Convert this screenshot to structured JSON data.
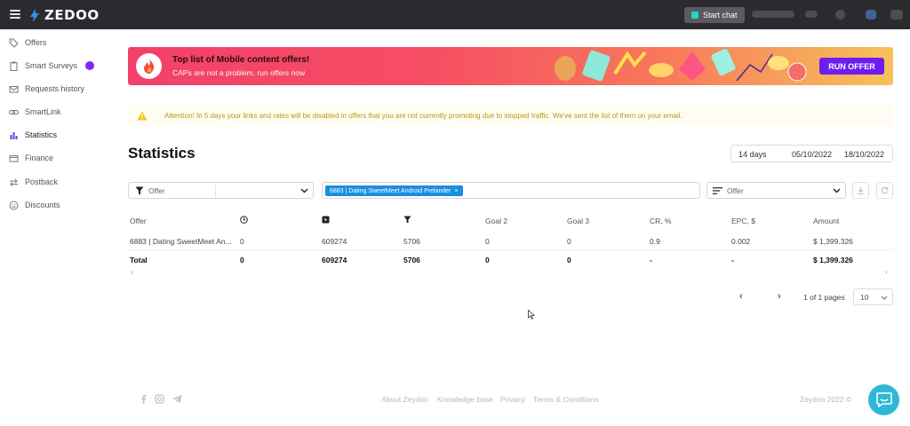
{
  "topbar": {
    "logo": "ZEDOO",
    "start_chat": "Start chat"
  },
  "sidebar": {
    "items": [
      {
        "label": "Offers",
        "icon": "tag-icon"
      },
      {
        "label": "Smart Surveys",
        "icon": "clipboard-icon"
      },
      {
        "label": "Requests history",
        "icon": "mail-icon"
      },
      {
        "label": "SmartLink",
        "icon": "link-icon"
      },
      {
        "label": "Statistics",
        "icon": "bar-chart-icon"
      },
      {
        "label": "Finance",
        "icon": "card-icon"
      },
      {
        "label": "Postback",
        "icon": "swap-icon"
      },
      {
        "label": "Discounts",
        "icon": "smile-icon"
      }
    ]
  },
  "banner": {
    "title": "Top list of Mobile content offers!",
    "subtitle": "CAPs are not a problem, run offers now",
    "button": "RUN OFFER"
  },
  "alert": {
    "text": "Attention! In 5 days your links and rates will be disabled in offers that you are not currently promoting due to stopped traffic. We've sent the list of them on your email."
  },
  "page": {
    "title": "Statistics"
  },
  "date_range": {
    "preset": "14 days",
    "from": "05/10/2022",
    "to": "18/10/2022"
  },
  "filters": {
    "filter_type": "Offer",
    "selected_tag": "6883 | Dating SweetMeet Android Prelander",
    "group_by": "Offer"
  },
  "table": {
    "headers": [
      "Offer",
      "",
      "",
      "",
      "Goal 2",
      "Goal 3",
      "CR, %",
      "EPC, $",
      "Amount"
    ],
    "rows": [
      [
        "6883 | Dating SweetMeet An...",
        "0",
        "609274",
        "5706",
        "0",
        "0",
        "0.9",
        "0.002",
        "$ 1,399.326"
      ]
    ],
    "total": [
      "Total",
      "0",
      "609274",
      "5706",
      "0",
      "0",
      "-",
      "-",
      "$ 1,399.326"
    ]
  },
  "pagination": {
    "text": "1 of 1 pages",
    "page_size": "10"
  },
  "footer": {
    "links": [
      "About Zeydoo",
      "Knowledge base",
      "Privacy",
      "Terms & Conditions"
    ],
    "copyright": "Zeydoo 2022 ©"
  }
}
